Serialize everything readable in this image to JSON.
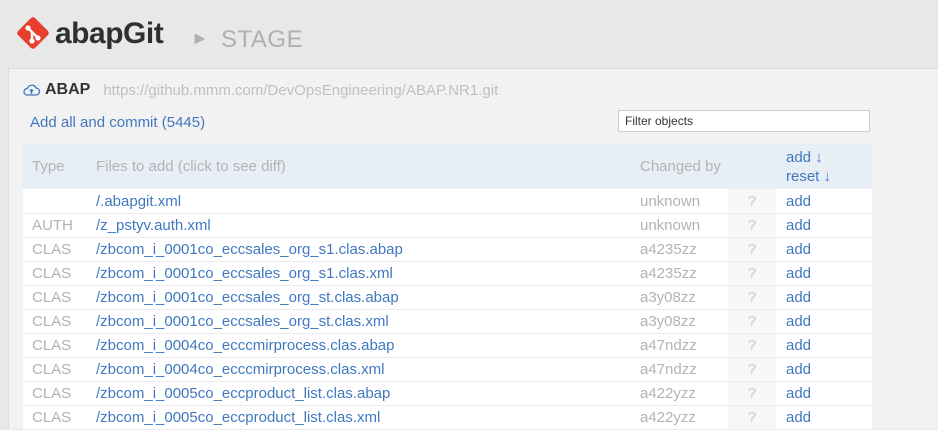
{
  "header": {
    "app_name": "abapGit",
    "separator_glyph": "►",
    "page_name": "STAGE",
    "logo_color": "#e83e2c"
  },
  "repo": {
    "icon": "cloud-upload-icon",
    "name": "ABAP",
    "url": "https://github.mmm.com/DevOpsEngineering/ABAP.NR1.git"
  },
  "actions": {
    "commit_all_label": "Add all and commit (5445)"
  },
  "filter": {
    "placeholder": "Filter objects",
    "value": ""
  },
  "table": {
    "columns": {
      "type": "Type",
      "files": "Files to add (click to see diff)",
      "changed_by": "Changed by",
      "add_all": "add ↓",
      "reset_all": "reset ↓"
    },
    "rows": [
      {
        "type": "",
        "file": "/.abapgit.xml",
        "changed_by": "unknown",
        "q": "?",
        "action": "add"
      },
      {
        "type": "AUTH",
        "file": "/z_pstyv.auth.xml",
        "changed_by": "unknown",
        "q": "?",
        "action": "add"
      },
      {
        "type": "CLAS",
        "file": "/zbcom_i_0001co_eccsales_org_s1.clas.abap",
        "changed_by": "a4235zz",
        "q": "?",
        "action": "add"
      },
      {
        "type": "CLAS",
        "file": "/zbcom_i_0001co_eccsales_org_s1.clas.xml",
        "changed_by": "a4235zz",
        "q": "?",
        "action": "add"
      },
      {
        "type": "CLAS",
        "file": "/zbcom_i_0001co_eccsales_org_st.clas.abap",
        "changed_by": "a3y08zz",
        "q": "?",
        "action": "add"
      },
      {
        "type": "CLAS",
        "file": "/zbcom_i_0001co_eccsales_org_st.clas.xml",
        "changed_by": "a3y08zz",
        "q": "?",
        "action": "add"
      },
      {
        "type": "CLAS",
        "file": "/zbcom_i_0004co_ecccmirprocess.clas.abap",
        "changed_by": "a47ndzz",
        "q": "?",
        "action": "add"
      },
      {
        "type": "CLAS",
        "file": "/zbcom_i_0004co_ecccmirprocess.clas.xml",
        "changed_by": "a47ndzz",
        "q": "?",
        "action": "add"
      },
      {
        "type": "CLAS",
        "file": "/zbcom_i_0005co_eccproduct_list.clas.abap",
        "changed_by": "a422yzz",
        "q": "?",
        "action": "add"
      },
      {
        "type": "CLAS",
        "file": "/zbcom_i_0005co_eccproduct_list.clas.xml",
        "changed_by": "a422yzz",
        "q": "?",
        "action": "add"
      }
    ]
  }
}
